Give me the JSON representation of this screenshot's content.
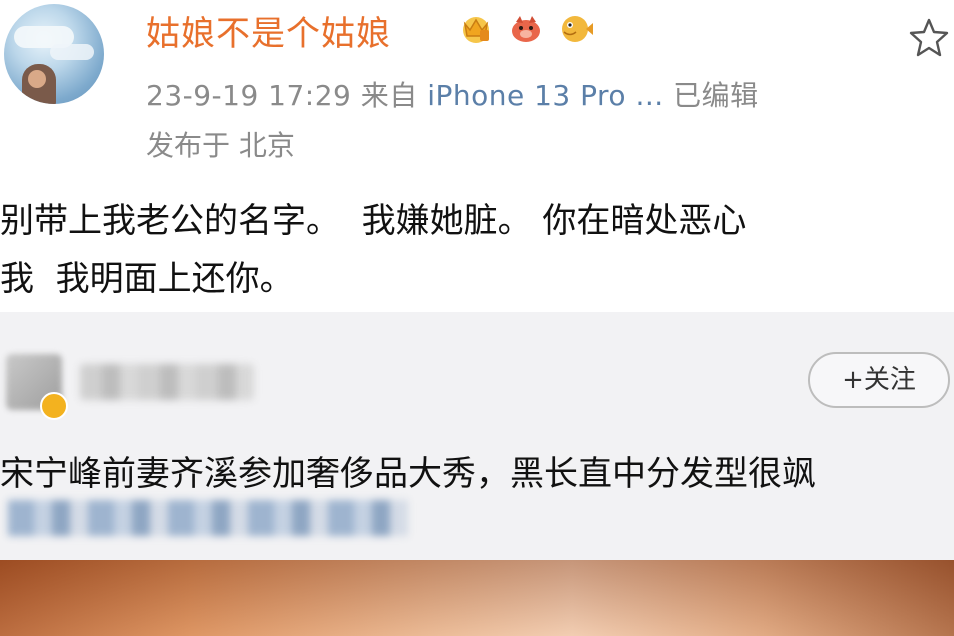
{
  "post": {
    "username": "姑娘不是个姑娘",
    "badges": [
      "crown-badge-icon",
      "piggy-badge-icon",
      "pufferfish-badge-icon"
    ],
    "datetime": "23-9-19 17:29",
    "source_prefix": "来自",
    "source": "iPhone 13 Pro ...",
    "edited": "已编辑",
    "location": "发布于 北京",
    "content_line1": "别带上我老公的名字。  我嫌她脏。 你在暗处恶心",
    "content_line2": "我  我明面上还你。"
  },
  "repost": {
    "follow_label": "+关注",
    "text": "宋宁峰前妻齐溪参加奢侈品大秀，黑长直中分发型很飒"
  },
  "colors": {
    "username": "#e8702c",
    "meta": "#8a8a8a",
    "source": "#5b7fa8",
    "repost_bg": "#f2f2f4"
  }
}
